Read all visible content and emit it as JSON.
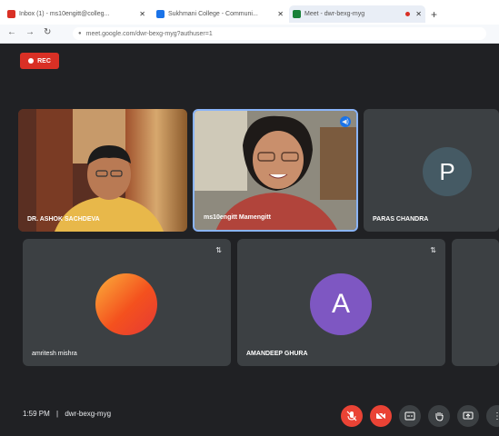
{
  "browser": {
    "tabs": [
      {
        "label": "Inbox (1) - ms10engitt@colleg...",
        "icon": "gmail-icon",
        "icon_color": "#d93025"
      },
      {
        "label": "Sukhmani College - Communi...",
        "icon": "classroom-icon",
        "icon_color": "#1a73e8"
      },
      {
        "label": "Meet - dwr-bexg-myg",
        "icon": "meet-icon",
        "icon_color": "#188038"
      }
    ],
    "new_tab": "+",
    "url": "meet.google.com/dwr-bexg-myg?authuser=1"
  },
  "meet": {
    "rec_label": "REC",
    "participants": [
      {
        "name": "DR. ASHOK SACHDEVA",
        "kind": "video"
      },
      {
        "name": "ms10engitt Mamengitt",
        "kind": "video",
        "speaking": true
      },
      {
        "name": "PARAS CHANDRA",
        "kind": "avatar",
        "initial": "P",
        "avatar_color": "#455a64"
      },
      {
        "name": "amritesh mishra",
        "kind": "avatar",
        "initial": "",
        "avatar_color": "#f4511e"
      },
      {
        "name": "AMANDEEP GHURA",
        "kind": "avatar",
        "initial": "A",
        "avatar_color": "#7e57c2"
      }
    ],
    "time": "1:59 PM",
    "separator": "|",
    "meeting_code": "dwr-bexg-myg",
    "controls": [
      "mic-off-icon",
      "camera-off-icon",
      "captions-icon",
      "raise-hand-icon",
      "present-icon",
      "more-icon"
    ]
  }
}
